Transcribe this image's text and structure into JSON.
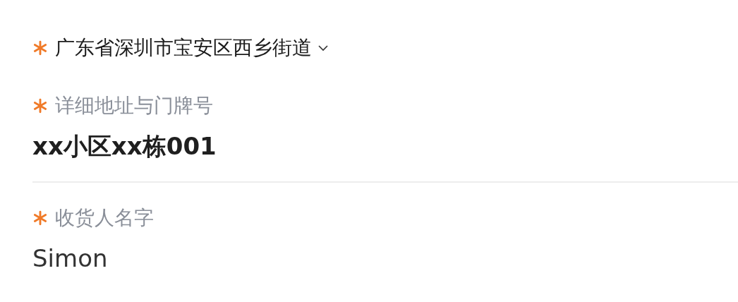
{
  "region": {
    "required": true,
    "value": "广东省深圳市宝安区西乡街道"
  },
  "fields": [
    {
      "kind": "address",
      "label": "详细地址与门牌号",
      "required": true,
      "value": "xx小区xx栋001"
    },
    {
      "kind": "name",
      "label": "收货人名字",
      "required": true,
      "value": "Simon"
    }
  ]
}
